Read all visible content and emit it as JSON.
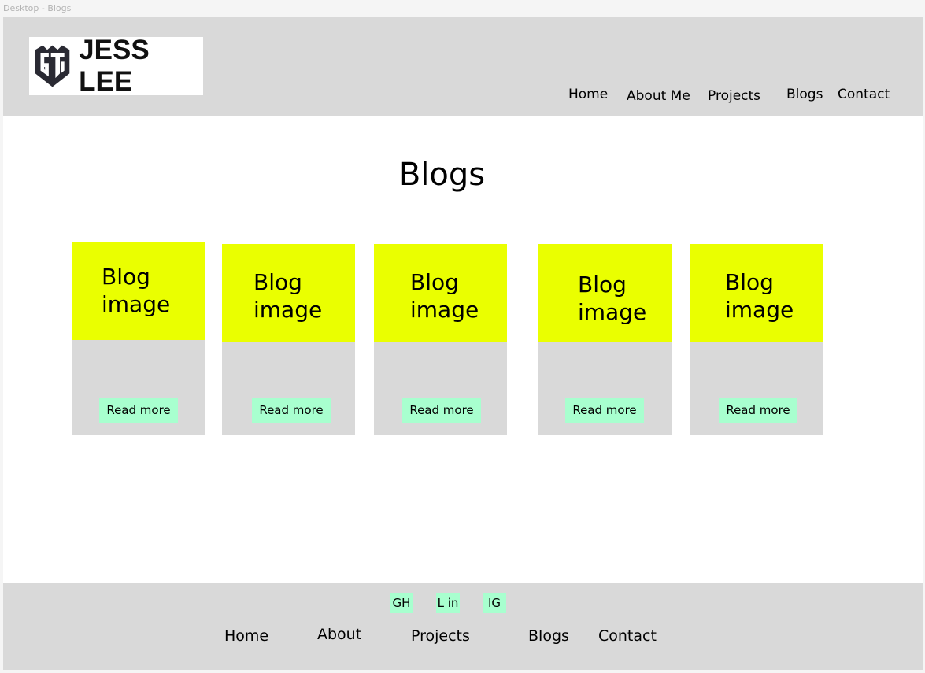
{
  "frame": {
    "label": "Desktop - Blogs"
  },
  "header": {
    "logo_text": "JESS LEE",
    "logo_icon": "shield-monogram-icon",
    "nav": [
      "Home",
      "About Me",
      "Projects",
      "Blogs",
      "Contact"
    ]
  },
  "main": {
    "title": "Blogs",
    "cards": [
      {
        "image_label": "Blog image",
        "button": "Read more"
      },
      {
        "image_label": "Blog image",
        "button": "Read more"
      },
      {
        "image_label": "Blog image",
        "button": "Read more"
      },
      {
        "image_label": "Blog image",
        "button": "Read more"
      },
      {
        "image_label": "Blog image",
        "button": "Read more"
      }
    ]
  },
  "footer": {
    "social": [
      "GH",
      "L in",
      "IG"
    ],
    "nav": [
      "Home",
      "About",
      "Projects",
      "Blogs",
      "Contact"
    ]
  },
  "colors": {
    "bar_gray": "#d9d9d9",
    "image_placeholder": "#eaff00",
    "button_mint": "#a8ffcf"
  }
}
